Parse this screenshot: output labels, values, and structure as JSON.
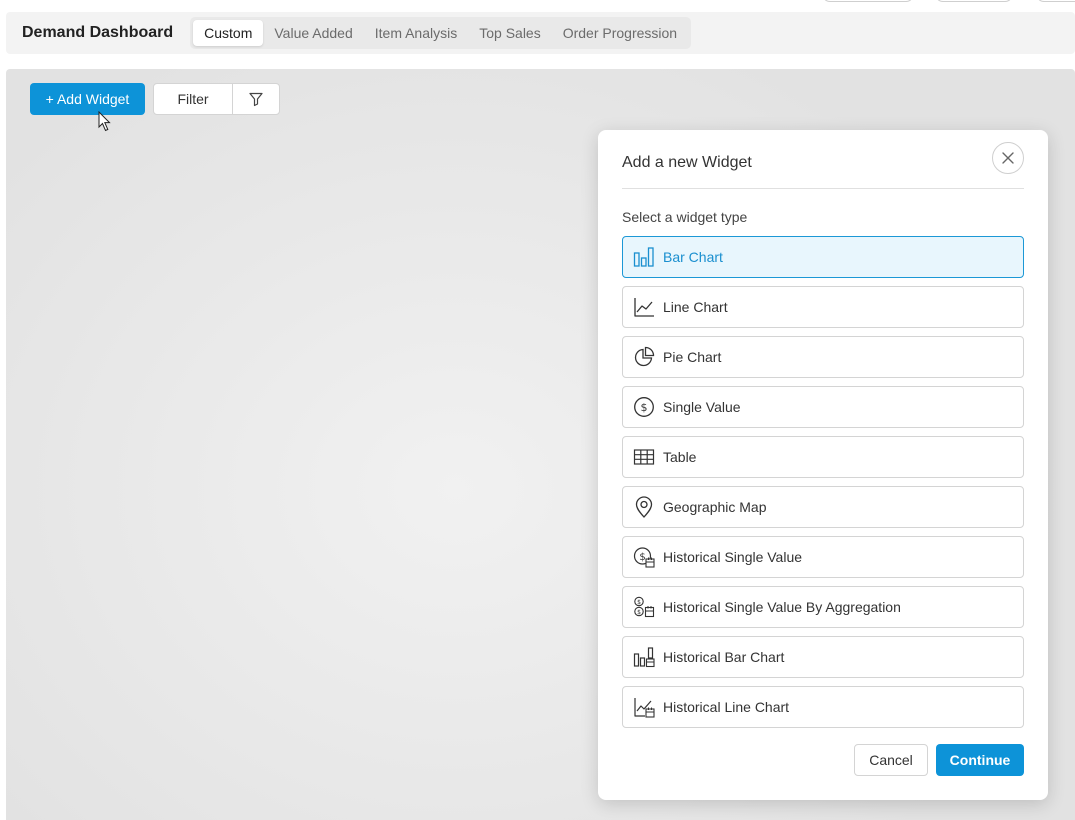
{
  "header": {
    "title": "Demand Dashboard",
    "tabs": [
      {
        "label": "Custom",
        "active": true
      },
      {
        "label": "Value Added",
        "active": false
      },
      {
        "label": "Item Analysis",
        "active": false
      },
      {
        "label": "Top Sales",
        "active": false
      },
      {
        "label": "Order Progression",
        "active": false
      }
    ]
  },
  "toolbar": {
    "add_widget_label": "+ Add Widget",
    "filter_label": "Filter",
    "filter_icon": "funnel-icon"
  },
  "modal": {
    "title": "Add a new Widget",
    "close_icon": "close-icon",
    "select_label": "Select a widget type",
    "options": [
      {
        "label": "Bar Chart",
        "icon": "bar-chart-icon",
        "selected": true
      },
      {
        "label": "Line Chart",
        "icon": "line-chart-icon",
        "selected": false
      },
      {
        "label": "Pie Chart",
        "icon": "pie-chart-icon",
        "selected": false
      },
      {
        "label": "Single Value",
        "icon": "dollar-circle-icon",
        "selected": false
      },
      {
        "label": "Table",
        "icon": "table-icon",
        "selected": false
      },
      {
        "label": "Geographic Map",
        "icon": "map-pin-icon",
        "selected": false
      },
      {
        "label": "Historical Single Value",
        "icon": "historical-dollar-icon",
        "selected": false
      },
      {
        "label": "Historical Single Value By Aggregation",
        "icon": "historical-aggregation-icon",
        "selected": false
      },
      {
        "label": "Historical Bar Chart",
        "icon": "historical-bar-chart-icon",
        "selected": false
      },
      {
        "label": "Historical Line Chart",
        "icon": "historical-line-chart-icon",
        "selected": false
      }
    ],
    "cancel_label": "Cancel",
    "continue_label": "Continue"
  },
  "colors": {
    "accent": "#0d93d8",
    "selected_bg": "#e8f6fd",
    "selected_border": "#1c98d6"
  }
}
